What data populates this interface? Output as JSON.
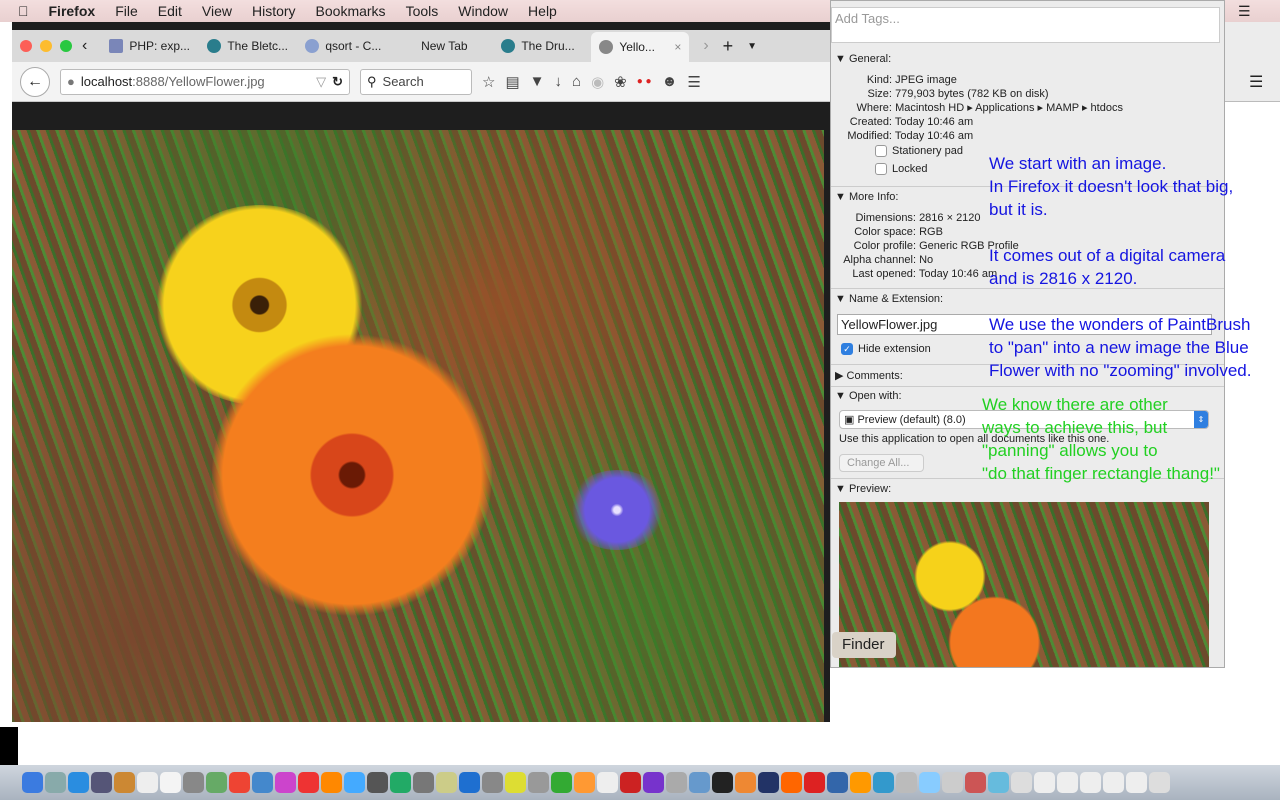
{
  "menubar": {
    "app": "Firefox",
    "items": [
      "File",
      "Edit",
      "View",
      "History",
      "Bookmarks",
      "Tools",
      "Window",
      "Help"
    ]
  },
  "browser": {
    "tabs": [
      {
        "label": "PHP: exp..."
      },
      {
        "label": "The Bletc..."
      },
      {
        "label": "qsort - C..."
      },
      {
        "label": "New Tab"
      },
      {
        "label": "The Dru..."
      },
      {
        "label": "Yello...",
        "active": true
      }
    ],
    "url_host": "localhost",
    "url_path": ":8888/YellowFlower.jpg",
    "search_placeholder": "Search"
  },
  "info": {
    "tags_placeholder": "Add Tags...",
    "general": {
      "title": "General:",
      "rows": [
        [
          "Kind:",
          "JPEG image"
        ],
        [
          "Size:",
          "779,903 bytes (782 KB on disk)"
        ],
        [
          "Where:",
          "Macintosh HD ▸ Applications ▸ MAMP ▸ htdocs"
        ],
        [
          "Created:",
          "Today 10:46 am"
        ],
        [
          "Modified:",
          "Today 10:46 am"
        ]
      ],
      "stationery": "Stationery pad",
      "locked": "Locked"
    },
    "more": {
      "title": "More Info:",
      "rows": [
        [
          "Dimensions:",
          "2816 × 2120"
        ],
        [
          "Color space:",
          "RGB"
        ],
        [
          "Color profile:",
          "Generic RGB Profile"
        ],
        [
          "Alpha channel:",
          "No"
        ],
        [
          "Last opened:",
          "Today 10:46 am"
        ]
      ]
    },
    "name_ext": {
      "title": "Name & Extension:",
      "filename": "YellowFlower.jpg",
      "hide": "Hide extension"
    },
    "comments": "Comments:",
    "open_with": {
      "title": "Open with:",
      "app": "Preview (default) (8.0)",
      "desc": "Use this application to open all documents like this one.",
      "change": "Change All..."
    },
    "preview": "Preview:"
  },
  "notes": {
    "blue": [
      "We start with an image.",
      "In Firefox it doesn't look that big,",
      "but it is.",
      "It comes out of a digital camera",
      "and is 2816 x 2120.",
      "We use the wonders of PaintBrush",
      " to \"pan\" into a new image the Blue",
      "Flower with no \"zooming\" involved."
    ],
    "green": [
      "We know there are other",
      "ways to achieve this, but",
      "\"panning\" allows you to",
      "\"do that finger rectangle thang!\""
    ]
  },
  "finder_label": "Finder",
  "colors": {
    "note_blue": "#1515e0",
    "note_green": "#22d022"
  }
}
